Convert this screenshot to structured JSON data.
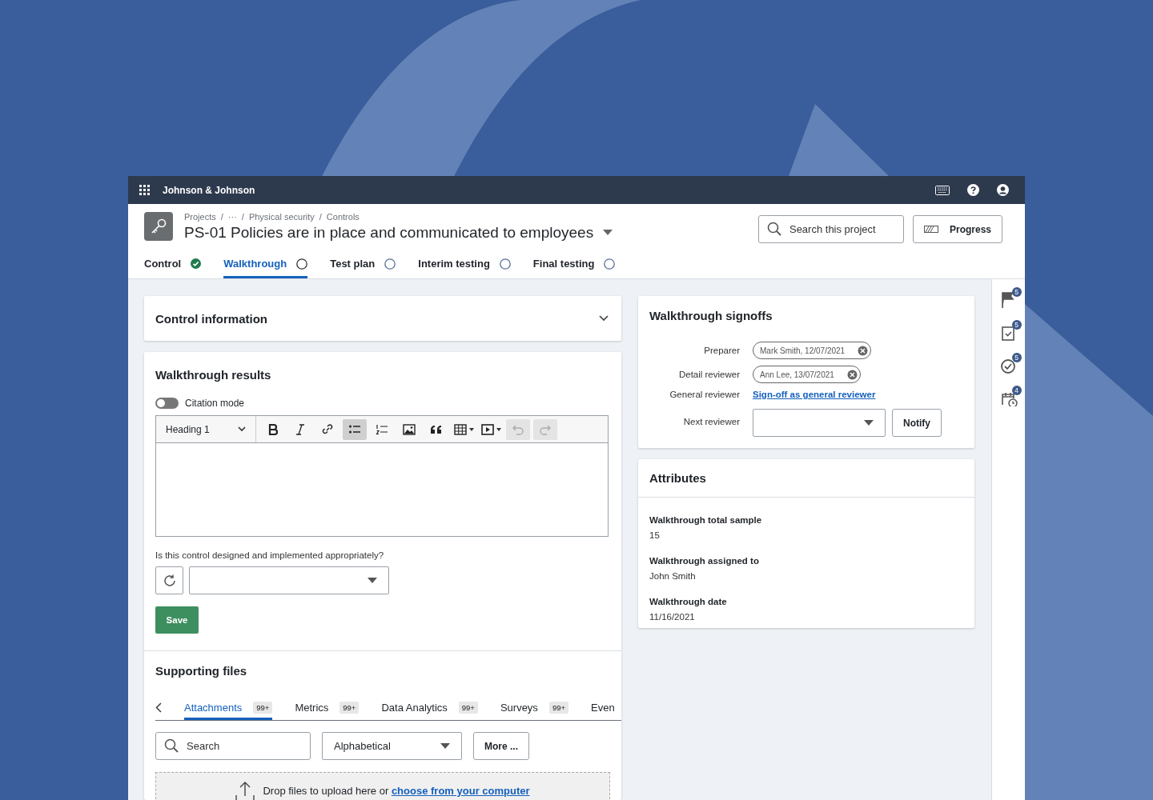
{
  "topbar": {
    "org": "Johnson & Johnson"
  },
  "header": {
    "breadcrumb": {
      "separator": "/",
      "items": [
        "Projects",
        "···",
        "Physical security",
        "Controls"
      ]
    },
    "title": "PS-01 Policies are in place and communicated to employees",
    "search": {
      "placeholder": "Search this project"
    },
    "progress_button": "Progress"
  },
  "stages": [
    {
      "label": "Control",
      "selected": false,
      "complete": true
    },
    {
      "label": "Walkthrough",
      "selected": true,
      "complete": false
    },
    {
      "label": "Test plan",
      "selected": false,
      "complete": false
    },
    {
      "label": "Interim testing",
      "selected": false,
      "complete": false
    },
    {
      "label": "Final testing",
      "selected": false,
      "complete": false
    }
  ],
  "control_information": {
    "title": "Control information",
    "expanded": false
  },
  "walkthrough_results": {
    "title": "Walkthrough results",
    "citation_mode": {
      "label": "Citation mode",
      "on": false
    },
    "editor": {
      "block_style": "Heading 1",
      "tools": [
        {
          "kind": "bold",
          "active": false,
          "disabled": false
        },
        {
          "kind": "italic",
          "active": false,
          "disabled": false
        },
        {
          "kind": "link",
          "active": false,
          "disabled": false
        },
        {
          "kind": "bullet-list",
          "active": true,
          "disabled": false
        },
        {
          "kind": "numbered-list",
          "active": false,
          "disabled": false
        },
        {
          "kind": "image",
          "active": false,
          "disabled": false
        },
        {
          "kind": "quote",
          "active": false,
          "disabled": false
        },
        {
          "kind": "table",
          "active": false,
          "disabled": false
        },
        {
          "kind": "media",
          "active": false,
          "disabled": false
        },
        {
          "kind": "undo",
          "active": false,
          "disabled": true
        },
        {
          "kind": "redo",
          "active": false,
          "disabled": true
        }
      ]
    },
    "question": "Is this control designed and implemented appropriately?",
    "save_button": "Save"
  },
  "supporting_files": {
    "title": "Supporting files",
    "tabs": [
      {
        "label": "Attachments",
        "count": "99+",
        "selected": true
      },
      {
        "label": "Metrics",
        "count": "99+",
        "selected": false
      },
      {
        "label": "Data Analytics",
        "count": "99+",
        "selected": false
      },
      {
        "label": "Surveys",
        "count": "99+",
        "selected": false
      },
      {
        "label": "Even",
        "selected": false
      }
    ],
    "search": {
      "placeholder": "Search"
    },
    "sort": "Alphabetical",
    "more_button": "More ...",
    "drop_text": "Drop files to upload here or ",
    "drop_link": "choose from your computer"
  },
  "signoffs": {
    "title": "Walkthrough signoffs",
    "rows": [
      {
        "label": "Preparer",
        "kind": "chip",
        "value": "Mark Smith, 12/07/2021"
      },
      {
        "label": "Detail reviewer",
        "kind": "chip",
        "value": "Ann Lee, 13/07/2021"
      },
      {
        "label": "General reviewer",
        "kind": "link",
        "value": "Sign-off as general reviewer"
      },
      {
        "label": "Next reviewer",
        "kind": "select",
        "button": "Notify"
      }
    ]
  },
  "attributes": {
    "title": "Attributes",
    "items": [
      {
        "label": "Walkthrough total sample",
        "value": "15"
      },
      {
        "label": "Walkthrough assigned to",
        "value": "John Smith"
      },
      {
        "label": "Walkthrough date",
        "value": "11/16/2021"
      }
    ]
  },
  "rail": [
    {
      "kind": "flag",
      "count": "5"
    },
    {
      "kind": "clipboard",
      "count": "5"
    },
    {
      "kind": "check-circle",
      "count": "5"
    },
    {
      "kind": "calendar",
      "count": "4"
    }
  ]
}
